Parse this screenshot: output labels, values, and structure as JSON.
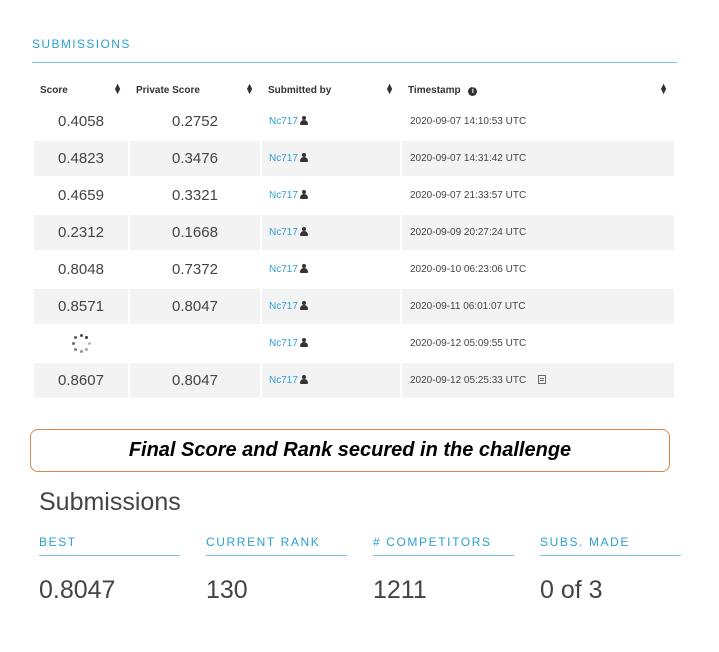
{
  "submissions": {
    "section_title": "SUBMISSIONS",
    "columns": {
      "score": "Score",
      "private_score": "Private Score",
      "submitted_by": "Submitted by",
      "timestamp": "Timestamp"
    },
    "rows": [
      {
        "score": "0.4058",
        "private_score": "0.2752",
        "user": "Nc717",
        "timestamp": "2020-09-07 14:10:53 UTC"
      },
      {
        "score": "0.4823",
        "private_score": "0.3476",
        "user": "Nc717",
        "timestamp": "2020-09-07 14:31:42 UTC"
      },
      {
        "score": "0.4659",
        "private_score": "0.3321",
        "user": "Nc717",
        "timestamp": "2020-09-07 21:33:57 UTC"
      },
      {
        "score": "0.2312",
        "private_score": "0.1668",
        "user": "Nc717",
        "timestamp": "2020-09-09 20:27:24 UTC"
      },
      {
        "score": "0.8048",
        "private_score": "0.7372",
        "user": "Nc717",
        "timestamp": "2020-09-10 06:23:06 UTC"
      },
      {
        "score": "0.8571",
        "private_score": "0.8047",
        "user": "Nc717",
        "timestamp": "2020-09-11 06:01:07 UTC"
      },
      {
        "score": "",
        "private_score": "",
        "user": "Nc717",
        "timestamp": "2020-09-12 05:09:55 UTC",
        "pending": true
      },
      {
        "score": "0.8607",
        "private_score": "0.8047",
        "user": "Nc717",
        "timestamp": "2020-09-12 05:25:33 UTC",
        "has_file": true
      }
    ]
  },
  "callout": "Final Score and Rank secured in the challenge",
  "summary": {
    "title": "Submissions",
    "stats": [
      {
        "label": "BEST",
        "value": "0.8047"
      },
      {
        "label": "CURRENT RANK",
        "value": "130"
      },
      {
        "label": "# COMPETITORS",
        "value": "1211"
      },
      {
        "label": "SUBS. MADE",
        "value": "0 of 3"
      }
    ]
  },
  "icons": {
    "sort": "sort-icon",
    "info": "info-icon",
    "user": "person-icon",
    "file": "file-icon",
    "loading": "loading-spinner-icon"
  },
  "colors": {
    "accent": "#2e9fd3",
    "callout_border": "#d9874a"
  }
}
